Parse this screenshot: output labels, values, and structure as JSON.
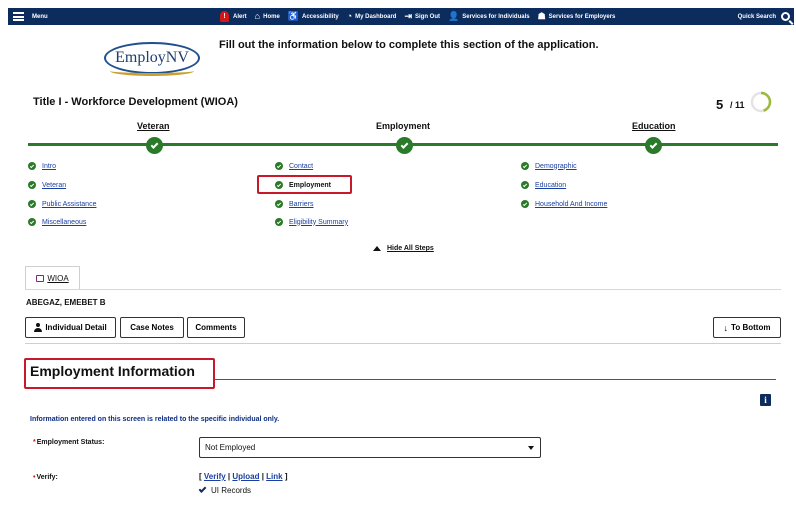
{
  "topbar": {
    "menu_label": "Menu",
    "links": [
      {
        "label": "Alert",
        "icon": "alert-icon",
        "glyph": "!"
      },
      {
        "label": "Home",
        "icon": "home-icon",
        "glyph": "⌂"
      },
      {
        "label": "Accessibility",
        "icon": "accessibility-icon",
        "glyph": "♿"
      },
      {
        "label": "My Dashboard",
        "icon": "dashboard-icon",
        "glyph": "◔"
      },
      {
        "label": "Sign Out",
        "icon": "sign-out-icon",
        "glyph": "⇥"
      },
      {
        "label": "Services for Individuals",
        "icon": "individuals-icon",
        "glyph": "👤"
      },
      {
        "label": "Services for Employers",
        "icon": "employers-icon",
        "glyph": "☗"
      }
    ],
    "quick_search": "Quick Search",
    "bar_color": "#0d2c5e"
  },
  "logo_text": "EmployNV",
  "instruction": "Fill out the information below to complete this section of the application.",
  "page_title": "Title I - Workforce Development (WIOA)",
  "progress": {
    "current": "5",
    "total": "/ 11",
    "fraction": 0.45
  },
  "stages": [
    "Veteran",
    "Employment",
    "Education"
  ],
  "steps": {
    "col1": [
      "Intro",
      "Veteran",
      "Public Assistance",
      "Miscellaneous"
    ],
    "col2": [
      "Contact",
      "Employment",
      "Barriers",
      "Eligibility Summary"
    ],
    "col3": [
      "Demographic",
      "Education",
      "Household And Income"
    ]
  },
  "hide_steps": "Hide All Steps",
  "tab_label": "WIOA",
  "person_name": "ABEGAZ, EMEBET B",
  "buttons": {
    "individual_detail": "Individual Detail",
    "case_notes": "Case Notes",
    "comments": "Comments",
    "to_bottom": "To Bottom"
  },
  "section_title": "Employment Information",
  "info_text": "Information entered on this screen is related to the specific individual only.",
  "fields": {
    "employment_status_label": "Employment Status:",
    "employment_status_value": "Not Employed",
    "verify_label": "Verify:",
    "verify_links": [
      "Verify",
      "Upload",
      "Link"
    ],
    "ui_records": "UI Records"
  },
  "colors": {
    "green": "#2a7a2a",
    "highlight_red": "#c8192a",
    "link_blue": "#1a3fa0",
    "navy": "#0d2c5e"
  }
}
